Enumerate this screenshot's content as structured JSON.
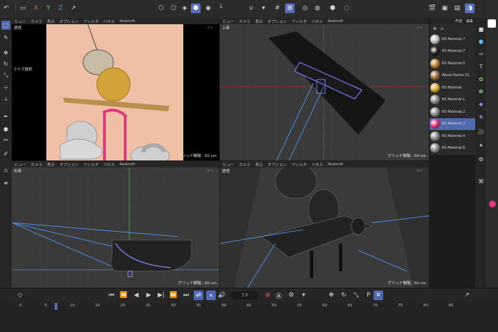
{
  "toolbar": {
    "xyz": [
      "X",
      "Y",
      "Z"
    ],
    "active_tool": "cube-tool"
  },
  "viewports": [
    {
      "id": "persp",
      "label": "透視",
      "menu": [
        "ビュー",
        "カメラ",
        "表示",
        "オプション",
        "フィルタ",
        "パネル",
        "Redshift"
      ],
      "grid": "グリッド間隔 : 50 cm",
      "sub": "ライブ選択"
    },
    {
      "id": "top",
      "label": "上面",
      "menu": [
        "ビュー",
        "カメラ",
        "表示",
        "オプション",
        "フィルタ",
        "パネル",
        "Redshift"
      ],
      "grid": "グリッド間隔 : 50 cm"
    },
    {
      "id": "right",
      "label": "右面",
      "menu": [
        "ビュー",
        "カメラ",
        "表示",
        "オプション",
        "フィルタ",
        "パネル",
        "Redshift"
      ],
      "grid": "グリッド間隔 : 50 cm"
    },
    {
      "id": "front",
      "label": "透視",
      "menu": [
        "ビュー",
        "カメラ",
        "表示",
        "オプション",
        "フィルタ",
        "パネル",
        "Redshift"
      ],
      "grid": "グリッド間隔 : 50 cm"
    }
  ],
  "materials_panel": {
    "menu": [
      "作成",
      "編集"
    ],
    "items": [
      {
        "name": "RS Material.7",
        "color": "#bdbdbd"
      },
      {
        "name": "RS Material.7",
        "color": "#222222"
      },
      {
        "name": "RS Material.5",
        "color": "#b8802a"
      },
      {
        "name": "Wood Planks 01",
        "color": "#9b6b3a"
      },
      {
        "name": "RS Material",
        "color": "#d9a531"
      },
      {
        "name": "RS Material.1",
        "color": "#8a8a8a"
      },
      {
        "name": "RS Material.2",
        "color": "#8a8a8a"
      },
      {
        "name": "RS Material.3",
        "color": "#e0337b"
      },
      {
        "name": "RS Material.4",
        "color": "#8a8a8a"
      },
      {
        "name": "RS Material.6",
        "color": "#8a8a8a"
      }
    ],
    "selected_index": 7
  },
  "transport": {
    "frame": "7 F"
  },
  "timeline_ticks": [
    "0",
    "5",
    "10",
    "15",
    "20",
    "25",
    "30",
    "35",
    "40",
    "45",
    "50",
    "55",
    "60",
    "65",
    "70",
    "75",
    "80",
    "85"
  ],
  "colors": {
    "accent": "#4f68b0",
    "background": "#3a3a3a"
  }
}
